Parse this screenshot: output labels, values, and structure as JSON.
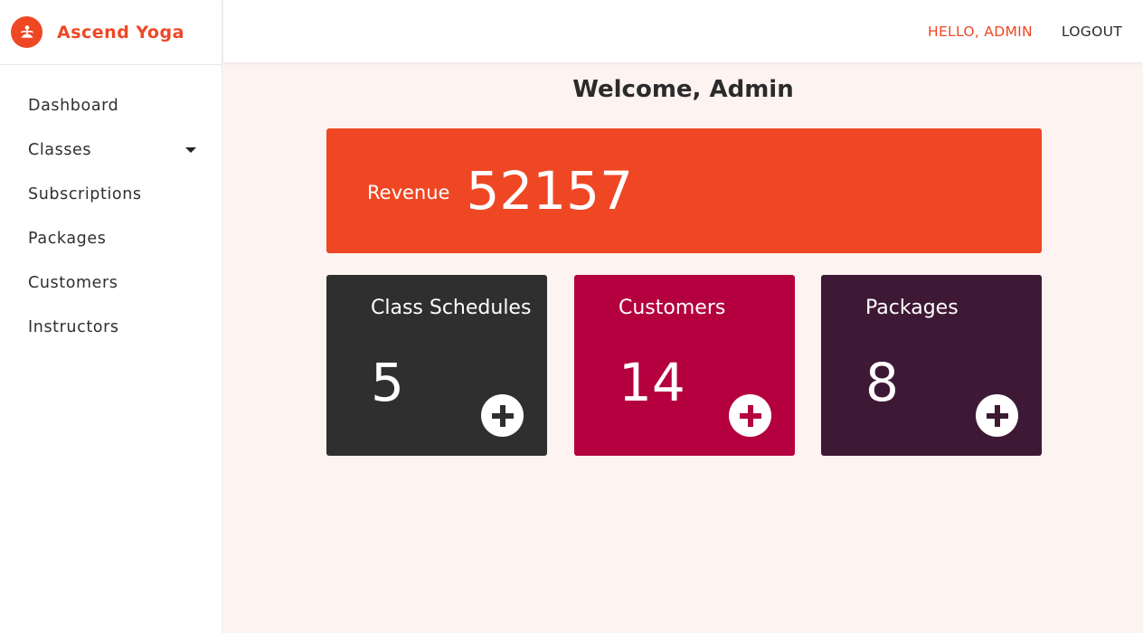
{
  "brand": {
    "name": "Ascend Yoga",
    "logo_icon": "yoga-pose-icon",
    "accent_color": "#ef4724"
  },
  "sidebar": {
    "items": [
      {
        "label": "Dashboard"
      },
      {
        "label": "Classes",
        "has_dropdown": true
      },
      {
        "label": "Subscriptions"
      },
      {
        "label": "Packages"
      },
      {
        "label": "Customers"
      },
      {
        "label": "Instructors"
      }
    ]
  },
  "header": {
    "greeting": "HELLO, ADMIN",
    "logout_label": "LOGOUT"
  },
  "main": {
    "welcome": "Welcome, Admin",
    "revenue": {
      "label": "Revenue",
      "value": "52157",
      "color": "#ef4724"
    },
    "cards": [
      {
        "title": "Class Schedules",
        "count": "5",
        "color": "#2f2f2f",
        "action_icon": "plus-circle-icon"
      },
      {
        "title": "Customers",
        "count": "14",
        "color": "#b4003f",
        "action_icon": "plus-circle-icon"
      },
      {
        "title": "Packages",
        "count": "8",
        "color": "#3e1935",
        "action_icon": "plus-circle-icon"
      }
    ]
  }
}
